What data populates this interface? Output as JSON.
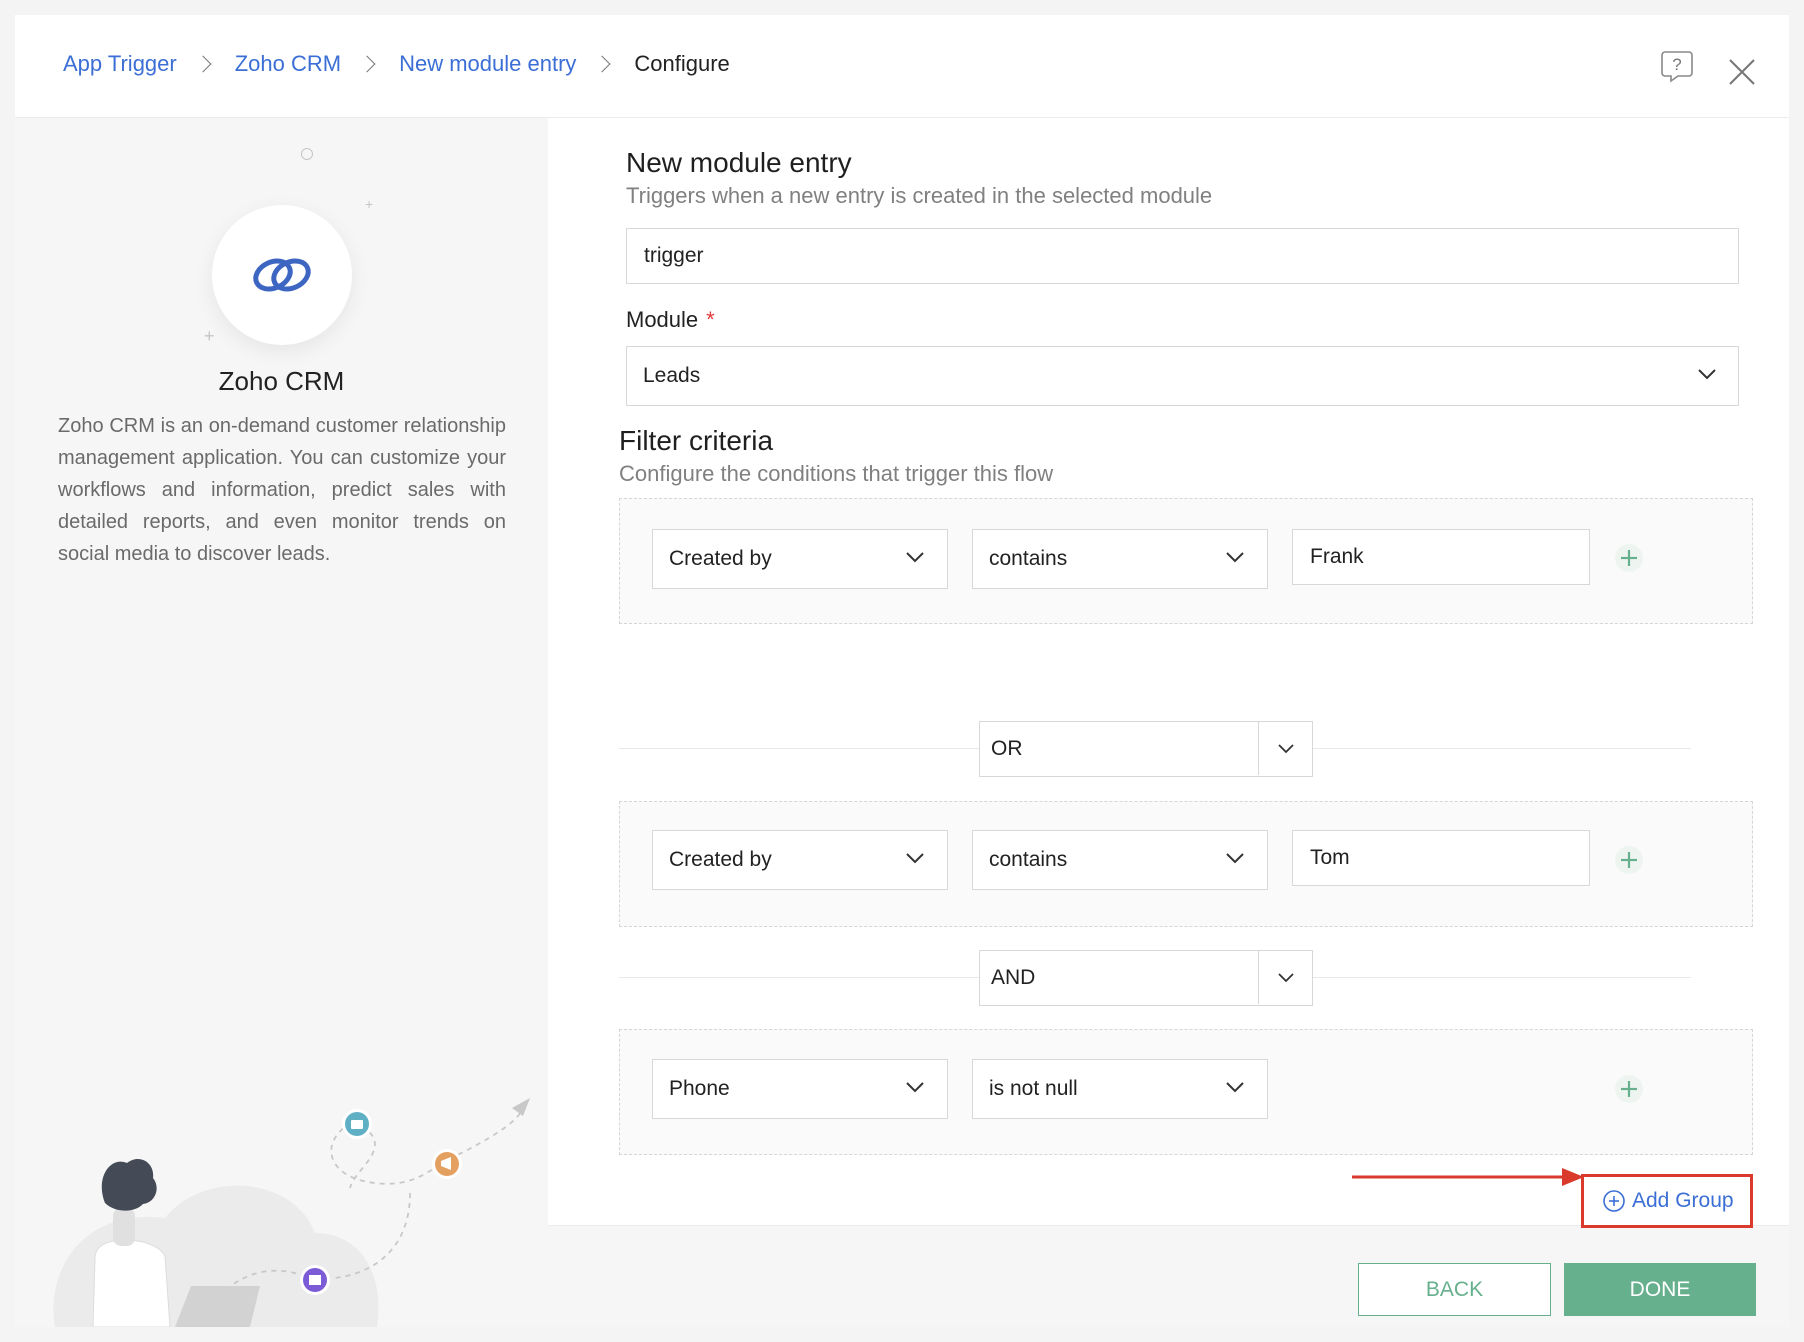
{
  "breadcrumb": {
    "items": [
      "App Trigger",
      "Zoho CRM",
      "New module entry"
    ],
    "current": "Configure"
  },
  "app": {
    "name": "Zoho CRM",
    "description": "Zoho CRM is an on-demand customer relationship management application. You can customize your workflows and information, predict sales with detailed reports, and even monitor trends on social media to discover leads."
  },
  "trigger": {
    "title": "New module entry",
    "subtitle": "Triggers when a new entry is created in the selected module",
    "name_value": "trigger"
  },
  "module": {
    "label": "Module",
    "required_mark": "*",
    "value": "Leads"
  },
  "filter": {
    "title": "Filter criteria",
    "subtitle": "Configure the conditions that trigger this flow",
    "groups": [
      {
        "field": "Created by",
        "operator": "contains",
        "value": "Frank"
      },
      {
        "field": "Created by",
        "operator": "contains",
        "value": "Tom"
      },
      {
        "field": "Phone",
        "operator": "is not null",
        "value": ""
      }
    ],
    "connectors": [
      "OR",
      "AND"
    ],
    "add_group_label": "Add Group"
  },
  "footer": {
    "back_label": "BACK",
    "done_label": "DONE"
  },
  "colors": {
    "link": "#3b6fd6",
    "accent": "#67b08e",
    "highlight": "#d93a2b"
  }
}
